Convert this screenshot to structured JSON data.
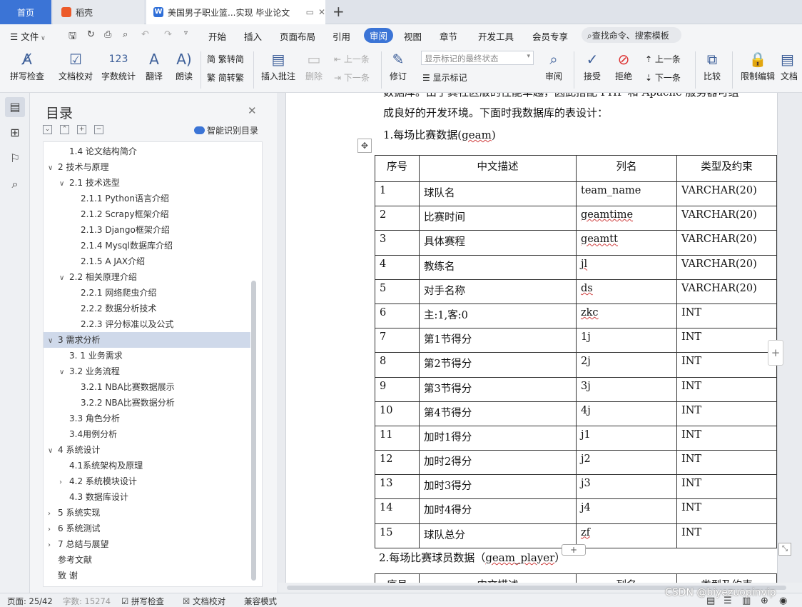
{
  "tabs": {
    "home": "首页",
    "daoke": "稻壳",
    "doc": "美国男子职业篮...实现 毕业论文",
    "new_tab": "+"
  },
  "menu": {
    "file": "文件",
    "items": [
      "开始",
      "插入",
      "页面布局",
      "引用",
      "审阅",
      "视图",
      "章节",
      "开发工具",
      "会员专享"
    ],
    "active": "审阅",
    "search": "查找命令、搜索模板"
  },
  "ribbon": {
    "spell": "拼写检查",
    "doccheck": "文档校对",
    "wordcount": "字数统计",
    "translate": "翻译",
    "read": "朗读",
    "trad2simp": "繁转简",
    "simp2trad": "简转繁",
    "insert_comment": "插入批注",
    "delete": "删除",
    "prev_comment": "上一条",
    "next_comment": "下一条",
    "revise": "修订",
    "markup_state": "显示标记的最终状态",
    "show_markup": "显示标记",
    "review": "审阅",
    "accept": "接受",
    "reject": "拒绝",
    "prev_change": "上一条",
    "next_change": "下一条",
    "compare": "比较",
    "restrict": "限制编辑",
    "docpermission": "文档"
  },
  "toc": {
    "title": "目录",
    "smart": "智能识别目录",
    "items": [
      {
        "label": "1.4 论文结构简介",
        "level": 2,
        "arrow": ""
      },
      {
        "label": "2 技术与原理",
        "level": 1,
        "arrow": "v"
      },
      {
        "label": "2.1 技术选型",
        "level": 2,
        "arrow": "v"
      },
      {
        "label": "2.1.1 Python语言介绍",
        "level": 3,
        "arrow": ""
      },
      {
        "label": "2.1.2 Scrapy框架介绍",
        "level": 3,
        "arrow": ""
      },
      {
        "label": "2.1.3 Django框架介绍",
        "level": 3,
        "arrow": ""
      },
      {
        "label": "2.1.4 Mysql数据库介绍",
        "level": 3,
        "arrow": ""
      },
      {
        "label": "2.1.5 A JAX介绍",
        "level": 3,
        "arrow": ""
      },
      {
        "label": "2.2 相关原理介绍",
        "level": 2,
        "arrow": "v"
      },
      {
        "label": "2.2.1 网络爬虫介绍",
        "level": 3,
        "arrow": ""
      },
      {
        "label": "2.2.2 数据分析技术",
        "level": 3,
        "arrow": ""
      },
      {
        "label": "2.2.3 评分标准以及公式",
        "level": 3,
        "arrow": ""
      },
      {
        "label": "3 需求分析",
        "level": 1,
        "arrow": "v",
        "selected": true
      },
      {
        "label": "3. 1 业务需求",
        "level": 2,
        "arrow": ""
      },
      {
        "label": "3.2 业务流程",
        "level": 2,
        "arrow": "v"
      },
      {
        "label": "3.2.1 NBA比赛数据展示",
        "level": 3,
        "arrow": ""
      },
      {
        "label": "3.2.2 NBA比赛数据分析",
        "level": 3,
        "arrow": ""
      },
      {
        "label": "3.3 角色分析",
        "level": 2,
        "arrow": ""
      },
      {
        "label": "3.4用例分析",
        "level": 2,
        "arrow": ""
      },
      {
        "label": "4 系统设计",
        "level": 1,
        "arrow": "v"
      },
      {
        "label": "4.1系统架构及原理",
        "level": 2,
        "arrow": ""
      },
      {
        "label": "4.2 系统模块设计",
        "level": 2,
        "arrow": ">"
      },
      {
        "label": "4.3  数据库设计",
        "level": 2,
        "arrow": ""
      },
      {
        "label": "5 系统实现",
        "level": 1,
        "arrow": ">"
      },
      {
        "label": "6 系统测试",
        "level": 1,
        "arrow": ">"
      },
      {
        "label": "7 总结与展望",
        "level": 1,
        "arrow": ">"
      },
      {
        "label": "参考文献",
        "level": 1,
        "arrow": ""
      },
      {
        "label": "致  谢",
        "level": 1,
        "arrow": ""
      }
    ]
  },
  "document": {
    "line1": "数据库。由于其社区版的性能卓越，因此搭配 PHP 和 Apache 服务器可组",
    "line2": "成良好的开发环境。下面时我数据库的表设计：",
    "table1_title_prefix": "1.每场比赛数据(",
    "table1_title_code": "geam",
    "table1_title_suffix": ")",
    "headers": [
      "序号",
      "中文描述",
      "列名",
      "类型及约束"
    ],
    "rows": [
      [
        "1",
        "球队名",
        "team_name",
        "VARCHAR(20)"
      ],
      [
        "2",
        "比赛时间",
        "geamtime",
        "VARCHAR(20)"
      ],
      [
        "3",
        "具体赛程",
        "geamtt",
        "VARCHAR(20)"
      ],
      [
        "4",
        "教练名",
        "jl",
        "VARCHAR(20)"
      ],
      [
        "5",
        "对手名称",
        "ds",
        "VARCHAR(20)"
      ],
      [
        "6",
        "主:1,客:0",
        "zkc",
        "INT"
      ],
      [
        "7",
        "第1节得分",
        "1j",
        "INT"
      ],
      [
        "8",
        "第2节得分",
        "2j",
        "INT"
      ],
      [
        "9",
        "第3节得分",
        "3j",
        "INT"
      ],
      [
        "10",
        "第4节得分",
        "4j",
        "INT"
      ],
      [
        "11",
        "加时1得分",
        "j1",
        "INT"
      ],
      [
        "12",
        "加时2得分",
        "j2",
        "INT"
      ],
      [
        "13",
        "加时3得分",
        "j3",
        "INT"
      ],
      [
        "14",
        "加时4得分",
        "j4",
        "INT"
      ],
      [
        "15",
        "球队总分",
        "zf",
        "INT"
      ]
    ],
    "table2_title_prefix": "2.每场比赛球员数据（",
    "table2_title_code": "geam_player",
    "table2_title_suffix": "）"
  },
  "status": {
    "page": "页面: 25/42",
    "words": "字数: 15274",
    "spell": "拼写检查",
    "doccheck": "文档校对",
    "compat": "兼容模式"
  },
  "watermark": "CSDN @biyezuopinvip"
}
